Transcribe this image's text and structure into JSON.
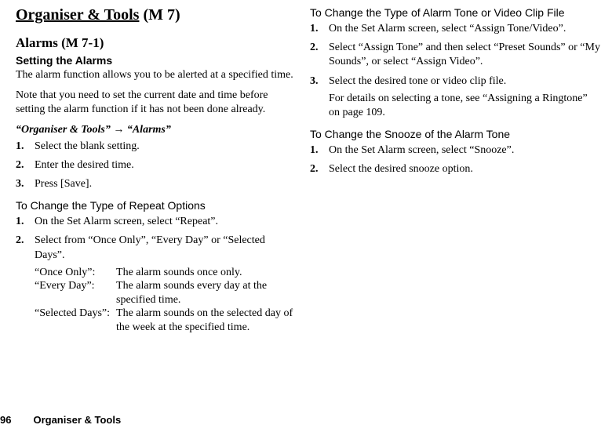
{
  "h1_title": "Organiser & Tools",
  "h1_code": " (M 7)",
  "h2_title": "Alarms (M 7-1)",
  "setting_heading": "Setting the Alarms",
  "intro_p1": "The alarm function allows you to be alerted at a specified time.",
  "intro_p2": "Note that you need to set the current date and time before setting the alarm function if it has not been done already.",
  "nav_path_a": "“Organiser & Tools”",
  "nav_arrow": " → ",
  "nav_path_b": "“Alarms”",
  "setting_steps": [
    {
      "num": "1.",
      "text": "Select the blank setting."
    },
    {
      "num": "2.",
      "text": "Enter the desired time."
    },
    {
      "num": "3.",
      "text": "Press [Save]."
    }
  ],
  "repeat_heading": "To Change the Type of Repeat Options",
  "repeat_steps": [
    {
      "num": "1.",
      "text": "On the Set Alarm screen, select “Repeat”."
    },
    {
      "num": "2.",
      "text": "Select from “Once Only”, “Every Day” or “Selected Days”."
    }
  ],
  "options": [
    {
      "label": "“Once Only”:",
      "desc": "The alarm sounds once only."
    },
    {
      "label": "“Every Day”:",
      "desc": "The alarm sounds every day at the specified time."
    },
    {
      "label": "“Selected Days”:",
      "desc": "The alarm sounds on the selected day of the week at the specified time."
    }
  ],
  "tone_heading": "To Change the Type of Alarm Tone or Video Clip File",
  "tone_steps": [
    {
      "num": "1.",
      "text": "On the Set Alarm screen, select “Assign Tone/Video”."
    },
    {
      "num": "2.",
      "text": "Select “Assign Tone” and then select “Preset Sounds” or “My Sounds”, or select “Assign Video”."
    },
    {
      "num": "3.",
      "text": "Select the desired tone or video clip file.",
      "sub": "For details on selecting a tone, see “Assigning a Ringtone” on page 109."
    }
  ],
  "snooze_heading": "To Change the Snooze of the Alarm Tone",
  "snooze_steps": [
    {
      "num": "1.",
      "text": "On the Set Alarm screen, select “Snooze”."
    },
    {
      "num": "2.",
      "text": "Select the desired snooze option."
    }
  ],
  "footer_page": "96",
  "footer_title": "Organiser & Tools"
}
